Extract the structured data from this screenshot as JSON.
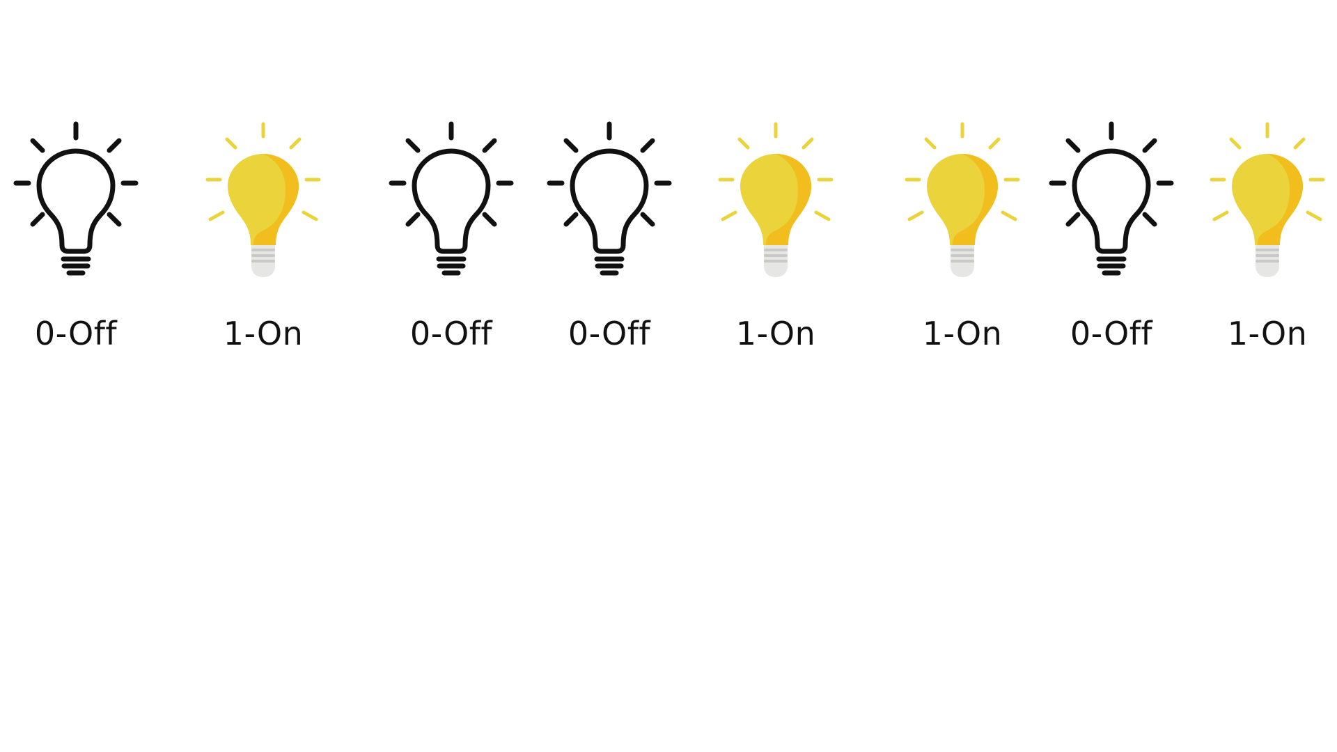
{
  "bulbs": [
    {
      "state": "off",
      "label": "0-Off"
    },
    {
      "state": "on",
      "label": "1-On"
    },
    {
      "state": "off",
      "label": "0-Off"
    },
    {
      "state": "off",
      "label": "0-Off"
    },
    {
      "state": "on",
      "label": "1-On"
    },
    {
      "state": "on",
      "label": "1-On"
    },
    {
      "state": "off",
      "label": "0-Off"
    },
    {
      "state": "on",
      "label": "1-On"
    }
  ],
  "colors": {
    "off_stroke": "#111111",
    "on_bulb": "#EAD33B",
    "on_shade": "#F2BE1E",
    "on_rays": "#EAD33B",
    "on_base": "#C9C9C6",
    "on_base_light": "#E6E6E4",
    "label": "#111111"
  },
  "icons": {
    "off": "lightbulb-off-icon",
    "on": "lightbulb-on-icon"
  }
}
